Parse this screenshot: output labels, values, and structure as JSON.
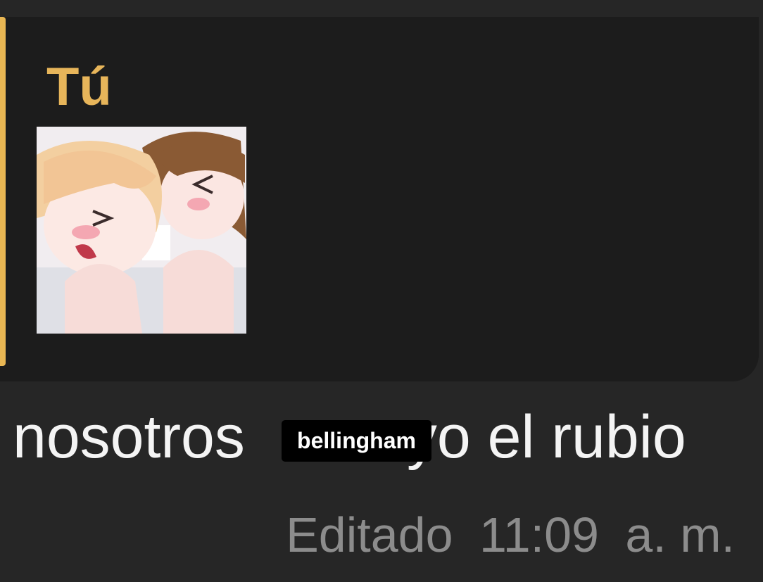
{
  "quoted_message": {
    "sender": "Tú",
    "accent_color": "#e8b653"
  },
  "message": {
    "text_before": "nosotros",
    "text_after": "yo el rubio",
    "overlay_label": "bellingham",
    "edited_label": "Editado",
    "time": "11:09",
    "period": "a. m."
  }
}
